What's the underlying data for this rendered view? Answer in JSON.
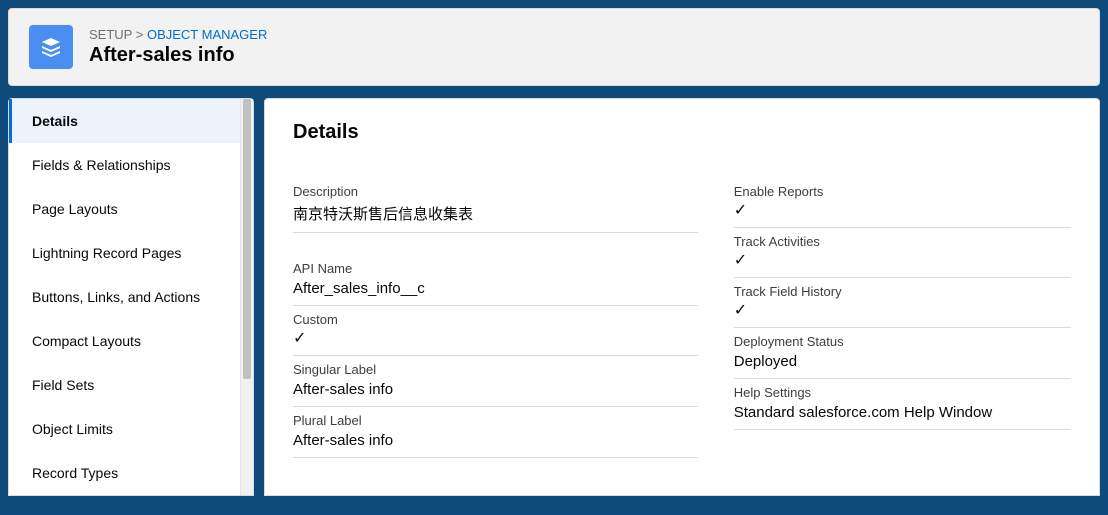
{
  "header": {
    "breadcrumb_setup": "SETUP",
    "breadcrumb_sep": ">",
    "breadcrumb_link": "OBJECT MANAGER",
    "title": "After-sales info"
  },
  "sidebar": {
    "items": [
      {
        "label": "Details",
        "selected": true
      },
      {
        "label": "Fields & Relationships",
        "selected": false
      },
      {
        "label": "Page Layouts",
        "selected": false
      },
      {
        "label": "Lightning Record Pages",
        "selected": false
      },
      {
        "label": "Buttons, Links, and Actions",
        "selected": false
      },
      {
        "label": "Compact Layouts",
        "selected": false
      },
      {
        "label": "Field Sets",
        "selected": false
      },
      {
        "label": "Object Limits",
        "selected": false
      },
      {
        "label": "Record Types",
        "selected": false
      }
    ]
  },
  "main": {
    "title": "Details",
    "left": [
      {
        "label": "Description",
        "value": "南京特沃斯售后信息收集表",
        "spacer": true
      },
      {
        "label": "API Name",
        "value": "After_sales_info__c"
      },
      {
        "label": "Custom",
        "value": "✓",
        "check": true
      },
      {
        "label": "Singular Label",
        "value": "After-sales info"
      },
      {
        "label": "Plural Label",
        "value": "After-sales info"
      }
    ],
    "right": [
      {
        "label": "Enable Reports",
        "value": "✓",
        "check": true
      },
      {
        "label": "Track Activities",
        "value": "✓",
        "check": true
      },
      {
        "label": "Track Field History",
        "value": "✓",
        "check": true
      },
      {
        "label": "Deployment Status",
        "value": "Deployed"
      },
      {
        "label": "Help Settings",
        "value": "Standard salesforce.com Help Window"
      }
    ]
  }
}
